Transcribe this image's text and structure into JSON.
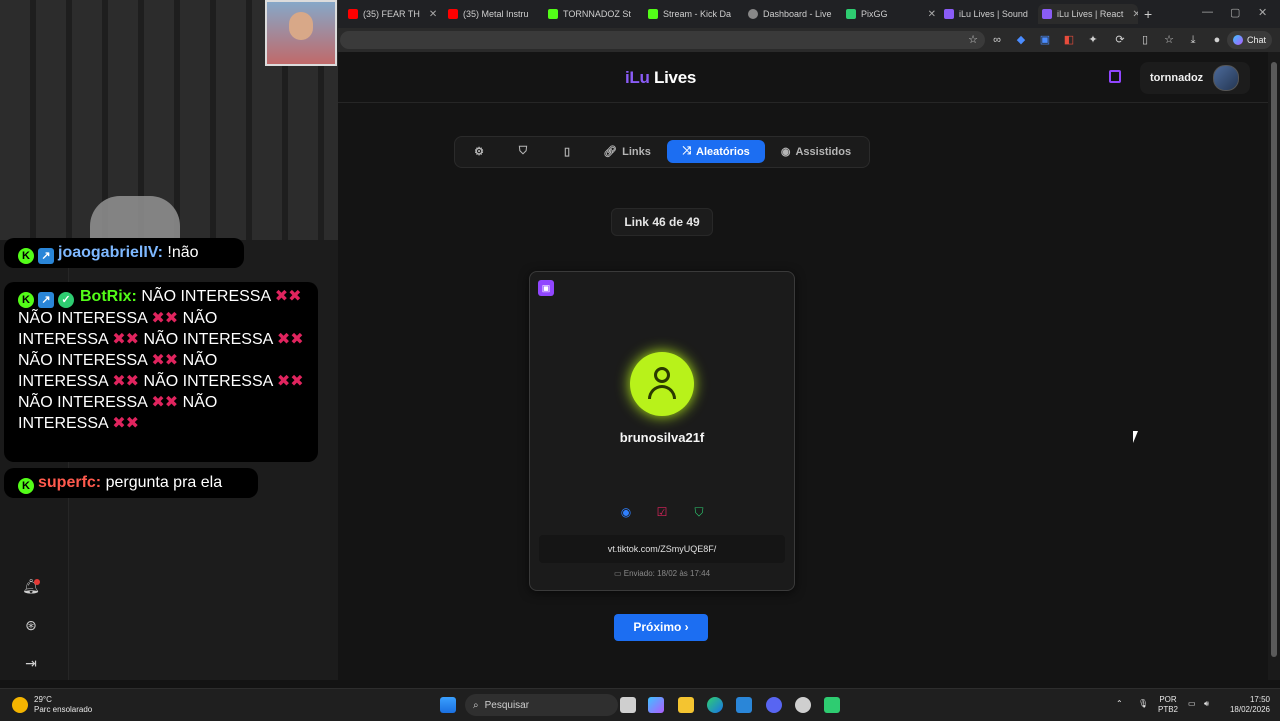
{
  "browser": {
    "tabs": [
      {
        "label": "(35) FEAR TH",
        "color": "#ff0000"
      },
      {
        "label": "(35) Metal Instru",
        "color": "#ff0000"
      },
      {
        "label": "TORNNADOZ St",
        "color": "#53fc18"
      },
      {
        "label": "Stream - Kick Da",
        "color": "#53fc18"
      },
      {
        "label": "Dashboard - Live",
        "color": "#888888"
      },
      {
        "label": "PixGG",
        "color": "#2ecc71"
      },
      {
        "label": "iLu Lives | Sound",
        "color": "#8a5cf6"
      },
      {
        "label": "iLu Lives | React",
        "color": "#8a5cf6"
      }
    ],
    "chat_label": "Chat"
  },
  "chat": {
    "messages": [
      {
        "user": "joaogabrielIV:",
        "text": " !não",
        "user_color": "#7eb8ff"
      },
      {
        "user": "BotRix:",
        "text": " NÃO INTERESSA ✖✖ NÃO INTERESSA ✖✖ NÃO INTERESSA ✖✖ NÃO INTERESSA ✖✖ NÃO INTERESSA ✖✖ NÃO INTERESSA ✖✖ NÃO INTERESSA ✖✖ NÃO INTERESSA ✖✖ NÃO INTERESSA ✖✖",
        "user_color": "#53fc18"
      },
      {
        "user": "superfc:",
        "text": " pergunta pra ela",
        "user_color": "#ff5a4d"
      }
    ]
  },
  "site": {
    "logo_ilu": "iLu",
    "logo_lives": "Lives",
    "username": "tornnadoz",
    "nav": [
      {
        "label": "",
        "icon": "gear-icon"
      },
      {
        "label": "",
        "icon": "shield-icon"
      },
      {
        "label": "",
        "icon": "bookmark-icon"
      },
      {
        "label": "Links",
        "icon": "link-icon"
      },
      {
        "label": "Aleatórios",
        "icon": "shuffle-icon"
      },
      {
        "label": "Assistidos",
        "icon": "eye-icon"
      }
    ],
    "counter": "Link 46 de 49",
    "card": {
      "username": "brunosilva21f",
      "link": "vt.tiktok.com/ZSmyUQE8F/",
      "sent": "Enviado: 18/02 às 17:44"
    },
    "next_label": "Próximo ›",
    "colors": {
      "accent": "#1c6ef2",
      "brand": "#8a5cf6",
      "twitch": "#9146ff",
      "avatar": "#b8f21a"
    }
  },
  "taskbar": {
    "temp": "29°C",
    "weather": "Parc ensolarado",
    "search": "Pesquisar",
    "lang1": "POR",
    "lang2": "PTB2",
    "time": "17:50",
    "date": "18/02/2026"
  }
}
